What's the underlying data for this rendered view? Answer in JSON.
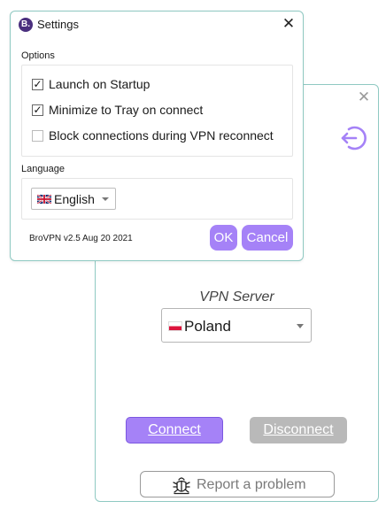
{
  "main_window": {
    "close_glyph": "✕",
    "logout_icon": "logout-arrow-icon",
    "server_label": "VPN Server",
    "server_selected": "Poland",
    "connect_label": "Connect",
    "disconnect_label": "Disconnect",
    "report_label": "Report a problem",
    "report_icon": "bug-icon",
    "accent_color": "#a582f7",
    "disabled_color": "#b9b9b9"
  },
  "settings": {
    "app_icon_letter": "B.",
    "title": "Settings",
    "close_glyph": "✕",
    "options_heading": "Options",
    "options": [
      {
        "label": "Launch on Startup",
        "checked": true
      },
      {
        "label": "Minimize to Tray on connect",
        "checked": true
      },
      {
        "label": "Block connections during VPN reconnect",
        "checked": false
      }
    ],
    "language_heading": "Language",
    "language_selected": "English",
    "version": "BroVPN v2.5 Aug 20 2021",
    "ok_label": "OK",
    "cancel_label": "Cancel"
  }
}
